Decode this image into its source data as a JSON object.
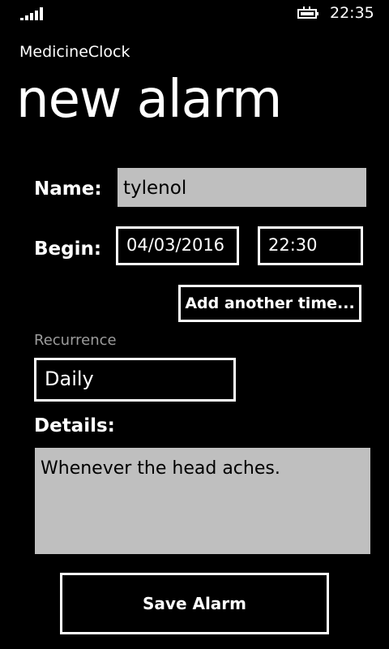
{
  "status_bar": {
    "time": "22:35",
    "signal_icon": "signal-strength-icon",
    "battery_icon": "battery-charging-icon"
  },
  "app": {
    "name": "MedicineClock",
    "page_title": "new alarm"
  },
  "form": {
    "name_label": "Name:",
    "name_value": "tylenol",
    "begin_label": "Begin:",
    "begin_date": "04/03/2016",
    "begin_time": "22:30",
    "add_time_button": "Add another time...",
    "recurrence_label": "Recurrence",
    "recurrence_value": "Daily",
    "details_label": "Details:",
    "details_value": "Whenever the head aches.",
    "save_button": "Save Alarm"
  },
  "colors": {
    "background": "#000000",
    "foreground": "#ffffff",
    "textbox_fill": "#bfbfbf",
    "muted_label": "#9c9c9c"
  }
}
